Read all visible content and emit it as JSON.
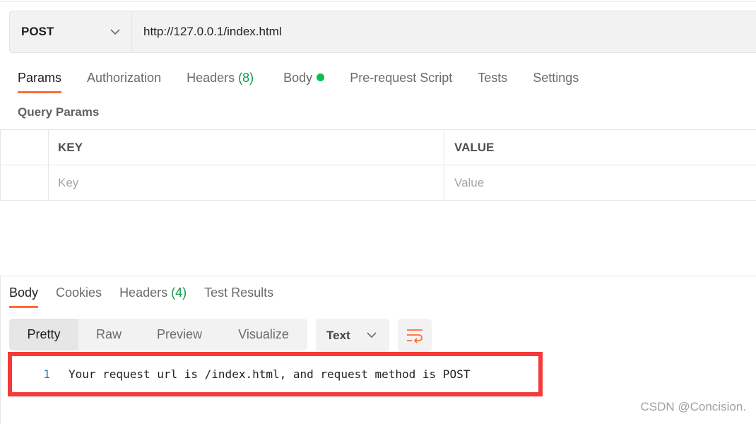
{
  "request": {
    "method": "POST",
    "url": "http://127.0.0.1/index.html"
  },
  "request_tabs": [
    {
      "label": "Params"
    },
    {
      "label": "Authorization"
    },
    {
      "label": "Headers",
      "count": "(8)"
    },
    {
      "label": "Body"
    },
    {
      "label": "Pre-request Script"
    },
    {
      "label": "Tests"
    },
    {
      "label": "Settings"
    }
  ],
  "query_params": {
    "title": "Query Params",
    "columns": [
      "KEY",
      "VALUE"
    ],
    "placeholders": [
      "Key",
      "Value"
    ]
  },
  "response_tabs": [
    {
      "label": "Body"
    },
    {
      "label": "Cookies"
    },
    {
      "label": "Headers",
      "count": "(4)"
    },
    {
      "label": "Test Results"
    }
  ],
  "view_modes": [
    "Pretty",
    "Raw",
    "Preview",
    "Visualize"
  ],
  "format": "Text",
  "response_body": {
    "line": "1",
    "text": "Your request url is /index.html, and request method is POST"
  },
  "watermark": "CSDN @Concision.",
  "colors": {
    "accent": "#ff6c37",
    "highlight_box": "#f53a3a",
    "success": "#0cbb52"
  }
}
